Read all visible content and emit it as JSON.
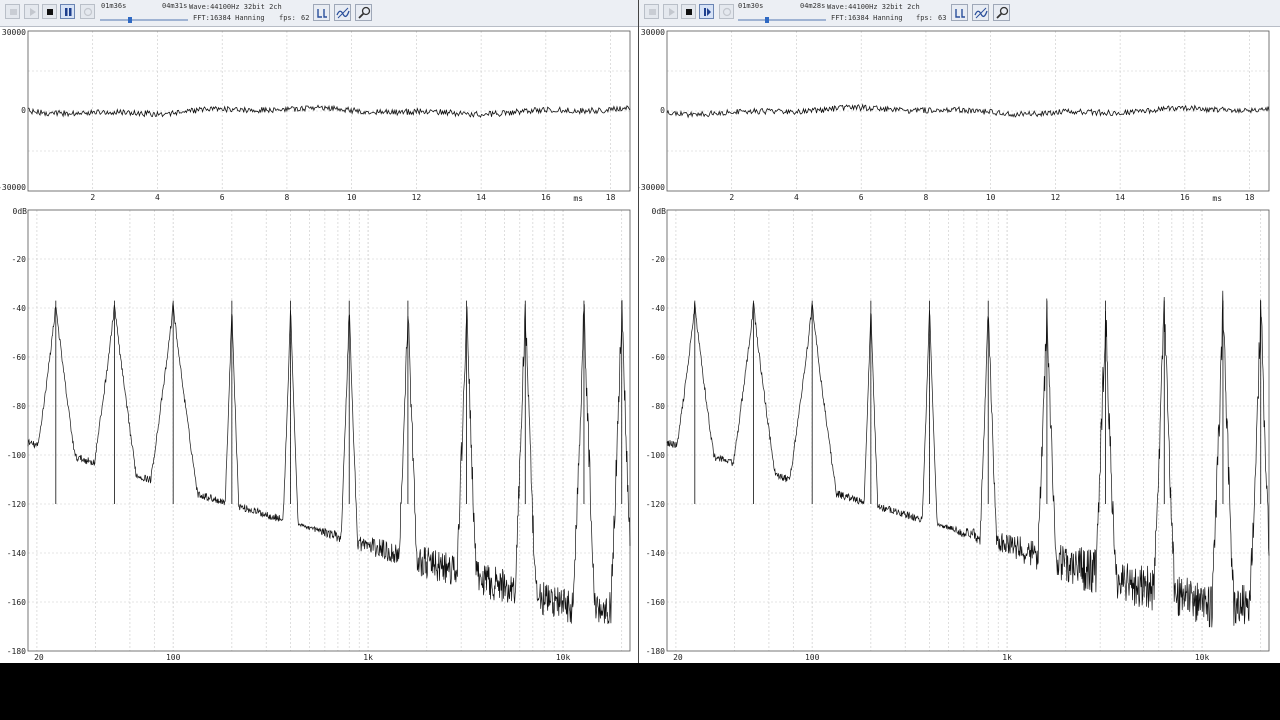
{
  "panels": [
    {
      "id": "left",
      "toolbar": {
        "elapsed": "01m36s",
        "total": "04m31s",
        "wave_info": "Wave:44100Hz 32bit 2ch",
        "fft_info": "FFT:16384 Hanning",
        "fps_label": "fps:",
        "fps_value": "62",
        "seek_fraction": 0.35,
        "active_button": "pause"
      },
      "wave": {
        "y_ticks": [
          "30000",
          "0",
          "-30000"
        ],
        "x_ticks": [
          "2",
          "4",
          "6",
          "8",
          "10",
          "12",
          "14",
          "16",
          "18"
        ],
        "x_unit": "ms"
      },
      "spectrum": {
        "y_ticks": [
          "0dB",
          "-20",
          "-40",
          "-60",
          "-80",
          "-100",
          "-120",
          "-140",
          "-160",
          "-180"
        ],
        "x_ticks": [
          "20",
          "100",
          "1k",
          "10k"
        ],
        "peaks_hz": [
          25,
          50,
          100,
          200,
          400,
          800,
          1600,
          3200,
          6400,
          12800,
          20000
        ]
      }
    },
    {
      "id": "right",
      "toolbar": {
        "elapsed": "01m30s",
        "total": "04m28s",
        "wave_info": "Wave:44100Hz 32bit 2ch",
        "fft_info": "FFT:16384 Hanning",
        "fps_label": "fps:",
        "fps_value": "63",
        "seek_fraction": 0.35,
        "active_button": "step"
      },
      "wave": {
        "y_ticks": [
          "30000",
          "0",
          "-30000"
        ],
        "x_ticks": [
          "2",
          "4",
          "6",
          "8",
          "10",
          "12",
          "14",
          "16",
          "18"
        ],
        "x_unit": "ms"
      },
      "spectrum": {
        "y_ticks": [
          "0dB",
          "-20",
          "-40",
          "-60",
          "-80",
          "-100",
          "-120",
          "-140",
          "-160",
          "-180"
        ],
        "x_ticks": [
          "20",
          "100",
          "1k",
          "10k"
        ],
        "peaks_hz": [
          25,
          50,
          100,
          200,
          400,
          800,
          1600,
          3200,
          6400,
          12800,
          20000
        ]
      }
    }
  ],
  "colors": {
    "grid": "#c9c9c9",
    "trace": "#111111",
    "toolbar": "#eceff4"
  },
  "icons": [
    "rewind-icon",
    "play-icon",
    "stop-icon",
    "pause-icon",
    "step-icon",
    "loop-icon",
    "channel-icon",
    "wave-settings-icon",
    "zoom-icon"
  ]
}
